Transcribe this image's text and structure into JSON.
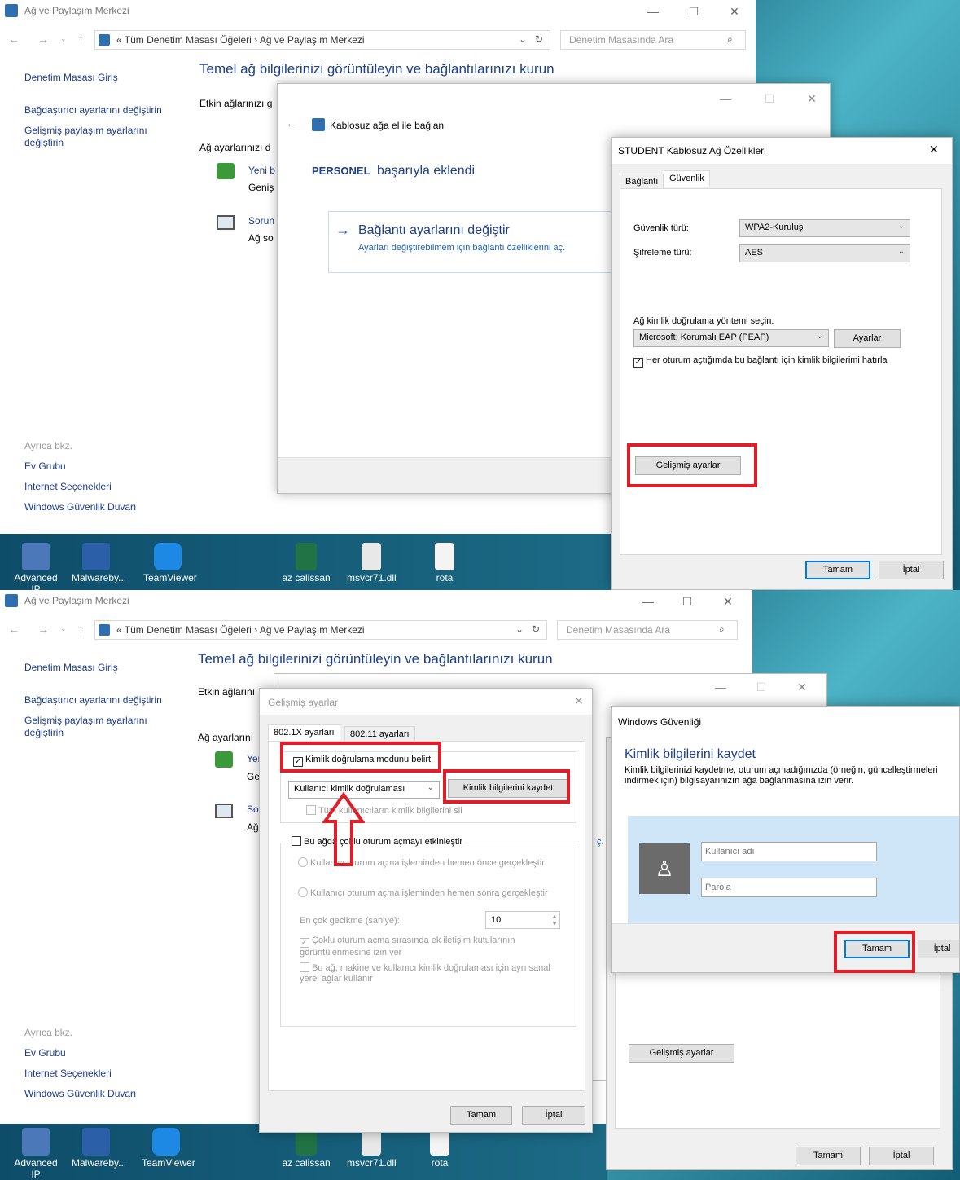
{
  "explorer": {
    "title": "Ağ ve Paylaşım Merkezi",
    "breadcrumb_root": "Tüm Denetim Masası Öğeleri",
    "breadcrumb_current": "Ağ ve Paylaşım Merkezi",
    "search_placeholder": "Denetim Masasında Ara",
    "sidebar": [
      "Denetim Masası Giriş",
      "Bağdaştırıcı ayarlarını değiştirin",
      "Gelişmiş paylaşım ayarlarını değiştirin"
    ],
    "see_also_label": "Ayrıca bkz.",
    "see_also": [
      "Ev Grubu",
      "Internet Seçenekleri",
      "Windows Güvenlik Duvarı"
    ],
    "heading": "Temel ağ bilgilerinizi görüntüleyin ve bağlantılarınızı kurun",
    "active_networks": "Etkin ağlarınızı g",
    "change_settings": "Ağ ayarlarınızı d",
    "new_link": "Yeni b",
    "new_desc": "Geniş",
    "trouble_link": "Sorun",
    "trouble_desc": "Ağ so",
    "active_networks_b": "Etkin ağlarını",
    "change_settings_b": "Ağ ayarlarını",
    "new_link_b": "Yer",
    "new_desc_b": "Ge",
    "trouble_link_b": "So",
    "trouble_desc_b": "Ağ"
  },
  "desktop": {
    "icons": [
      "Advanced IP",
      "Malwareby...",
      "TeamViewer",
      "az calissan",
      "msvcr71.dll",
      "rota"
    ]
  },
  "manual_connect": {
    "title": "Kablosuz ağa el ile bağlan",
    "network_name": "PERSONEL",
    "added_text": "başarıyla eklendi",
    "option_title": "Bağlantı ayarlarını değiştir",
    "option_desc": "Ayarları değiştirebilmem için bağlantı özelliklerini aç.",
    "option_desc_b": "ç."
  },
  "props": {
    "title": "STUDENT Kablosuz Ağ Özellikleri",
    "tabs": [
      "Bağlantı",
      "Güvenlik"
    ],
    "security_type_label": "Güvenlik türü:",
    "security_type_value": "WPA2-Kuruluş",
    "encryption_label": "Şifreleme türü:",
    "encryption_value": "AES",
    "auth_method_label": "Ağ kimlik doğrulama yöntemi seçin:",
    "auth_method_value": "Microsoft: Korumalı EAP (PEAP)",
    "settings_button": "Ayarlar",
    "remember_label": "Her oturum açtığımda bu bağlantı için kimlik bilgilerimi hatırla",
    "advanced_button": "Gelişmiş ayarlar",
    "ok_button": "Tamam",
    "cancel_button": "İptal"
  },
  "advanced": {
    "title": "Gelişmiş ayarlar",
    "tabs": [
      "802.1X ayarları",
      "802.11 ayarları"
    ],
    "specify_auth": "Kimlik doğrulama modunu belirt",
    "auth_mode_value": "Kullanıcı kimlik doğrulaması",
    "save_credentials_button": "Kimlik bilgilerini kaydet",
    "delete_all": "Tüm kullanıcıların kimlik bilgilerini sil",
    "sso_enable": "Bu ağda çoklu oturum açmayı etkinleştir",
    "sso_before": "Kullanıcı oturum açma işleminden hemen önce gerçekleştir",
    "sso_after": "Kullanıcı oturum açma işleminden hemen sonra gerçekleştir",
    "max_delay_label": "En çok gecikme (saniye):",
    "max_delay_value": "10",
    "allow_dialogs": "Çoklu oturum açma sırasında ek iletişim kutularının görüntülenmesine izin ver",
    "separate_vlans": "Bu ağ, makine ve kullanıcı kimlik doğrulaması için ayrı sanal yerel ağlar kullanır",
    "ok_button": "Tamam",
    "cancel_button": "İptal"
  },
  "security_dialog": {
    "title": "Windows Güvenliği",
    "heading": "Kimlik bilgilerini kaydet",
    "description": "Kimlik bilgilerinizi kaydetme, oturum açmadığınızda (örneğin, güncelleştirmeleri indirmek için) bilgisayarınızın ağa bağlanmasına izin verir.",
    "username_placeholder": "Kullanıcı adı",
    "password_placeholder": "Parola",
    "ok_button": "Tamam",
    "cancel_button": "İptal"
  },
  "colors": {
    "highlight": "#e01e2a",
    "link": "#1a3a8c",
    "accent": "#0078d7"
  }
}
